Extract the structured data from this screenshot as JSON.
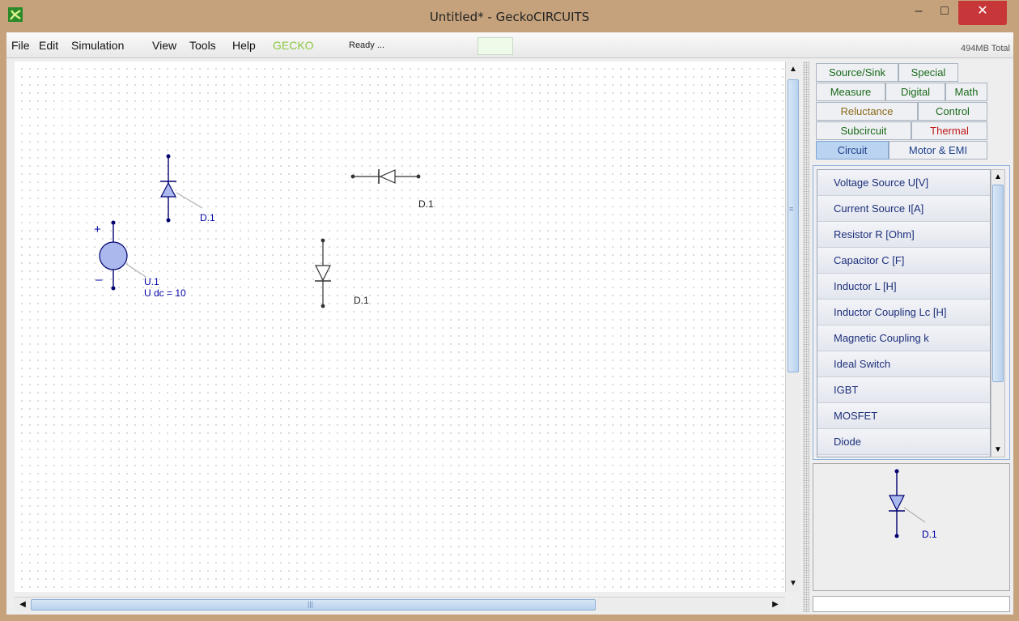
{
  "window": {
    "title": "Untitled*  -  GeckoCIRCUITS",
    "buttons": {
      "minimize": "–",
      "maximize": "□",
      "close": "✕"
    }
  },
  "menu": {
    "items": [
      "File",
      "Edit",
      "Simulation",
      "View",
      "Tools",
      "Help",
      "GECKO"
    ],
    "status": "Ready ...",
    "memory": "494MB Total"
  },
  "canvas": {
    "components": {
      "diode_blue_label": "D.1",
      "diode_horizontal_label": "D.1",
      "source_label": "U.1",
      "source_value": "U dc = 10",
      "source_plus": "+",
      "source_minus": "–",
      "diode_gray_label": "D.1"
    }
  },
  "tabs": {
    "row1": [
      "Source/Sink",
      "Special"
    ],
    "row2": [
      "Measure",
      "Digital",
      "Math"
    ],
    "row3": [
      "Reluctance",
      "Control"
    ],
    "row4": [
      "Subcircuit",
      "Thermal"
    ],
    "row5": [
      "Circuit",
      "Motor & EMI"
    ],
    "active": "Circuit"
  },
  "component_list": [
    "Voltage Source U[V]",
    "Current Source I[A]",
    "Resistor R [Ohm]",
    "Capacitor C [F]",
    "Inductor L [H]",
    "Inductor Coupling Lc [H]",
    "Magnetic Coupling k",
    "Ideal Switch",
    "IGBT",
    "MOSFET",
    "Diode"
  ],
  "preview": {
    "label": "D.1"
  },
  "colors": {
    "title_bar": "#c5a27c",
    "close_button": "#c7373a",
    "component_blue": "#0000aa",
    "gecko_menu": "#8cc63f",
    "thermal_tab": "#c01818"
  },
  "icons": [
    "gecko-app-icon",
    "scroll-up-arrow",
    "scroll-down-arrow",
    "scroll-left-arrow",
    "scroll-right-arrow"
  ]
}
